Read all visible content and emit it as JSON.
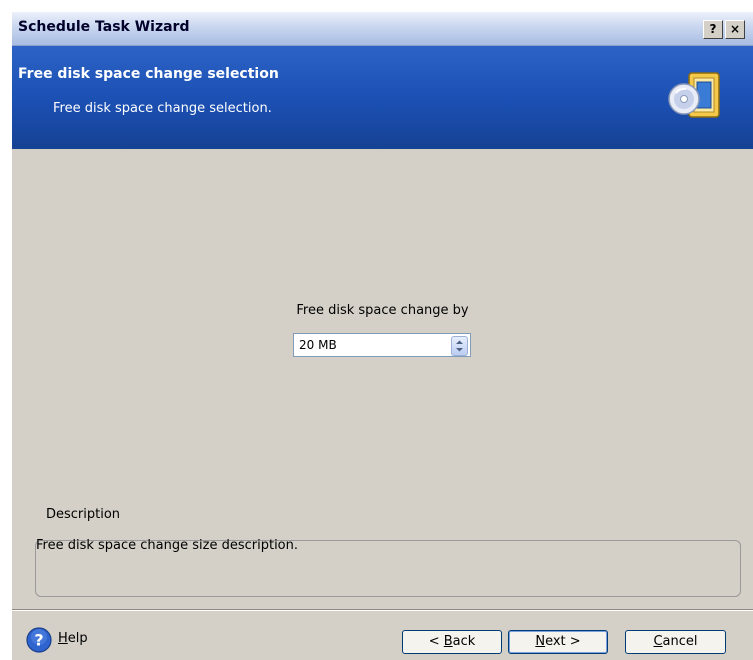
{
  "window": {
    "title": "Schedule Task Wizard",
    "help_button": "?",
    "close_button": "×"
  },
  "header": {
    "title": "Free disk space change selection",
    "subtitle": "Free disk space change selection.",
    "icon": "wizard-disk-door-icon"
  },
  "main": {
    "field_label": "Free disk space change by",
    "spin_value": "20 MB"
  },
  "description": {
    "legend": "Description",
    "text": "Free disk space change size description."
  },
  "footer": {
    "help": {
      "mnemonic": "H",
      "rest": "elp"
    },
    "back": {
      "prefix": "< ",
      "mnemonic": "B",
      "rest": "ack"
    },
    "next": {
      "mnemonic": "N",
      "rest": "ext >"
    },
    "cancel": {
      "mnemonic": "C",
      "rest": "ancel"
    }
  },
  "colors": {
    "header_blue": "#1b4fb2",
    "dialog_gray": "#d4d0c8",
    "button_border": "#003c74"
  }
}
